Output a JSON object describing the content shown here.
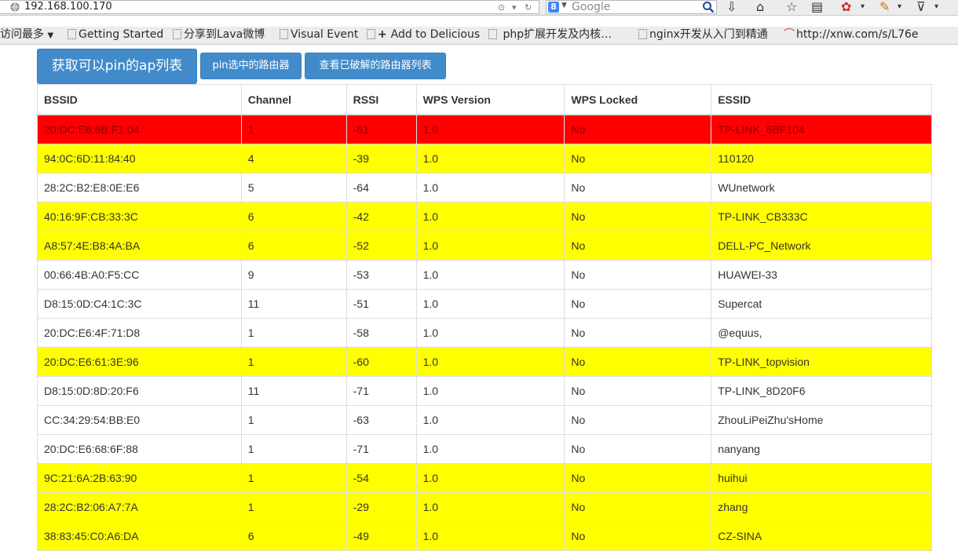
{
  "browser": {
    "url": "192.168.100.170",
    "search_placeholder": "Google",
    "search_engine_letter": "8"
  },
  "bookmarks": {
    "most_visited": "访问最多",
    "items": [
      "Getting Started",
      "分享到Lava微博",
      "Visual Event",
      "Add to Delicious",
      "php扩展开发及内核…",
      "nginx开发从入门到精通",
      "http://xnw.com/s/L76e"
    ]
  },
  "actions": {
    "get_pin_ap": "获取可以pin的ap列表",
    "pin_selected": "pin选中的路由器",
    "view_cracked": "查看已破解的路由器列表"
  },
  "table": {
    "headers": [
      "BSSID",
      "Channel",
      "RSSI",
      "WPS Version",
      "WPS Locked",
      "ESSID"
    ],
    "rows": [
      {
        "highlight": "red",
        "cells": [
          "20:DC:E6:6B:F1:04",
          "1",
          "-61",
          "1.0",
          "No",
          "TP-LINK_6BF104"
        ]
      },
      {
        "highlight": "yellow",
        "cells": [
          "94:0C:6D:11:84:40",
          "4",
          "-39",
          "1.0",
          "No",
          "110120"
        ]
      },
      {
        "highlight": "white",
        "cells": [
          "28:2C:B2:E8:0E:E6",
          "5",
          "-64",
          "1.0",
          "No",
          "WUnetwork"
        ]
      },
      {
        "highlight": "yellow",
        "cells": [
          "40:16:9F:CB:33:3C",
          "6",
          "-42",
          "1.0",
          "No",
          "TP-LINK_CB333C"
        ]
      },
      {
        "highlight": "yellow",
        "cells": [
          "A8:57:4E:B8:4A:BA",
          "6",
          "-52",
          "1.0",
          "No",
          "DELL-PC_Network"
        ]
      },
      {
        "highlight": "white",
        "cells": [
          "00:66:4B:A0:F5:CC",
          "9",
          "-53",
          "1.0",
          "No",
          "HUAWEI-33"
        ]
      },
      {
        "highlight": "white",
        "cells": [
          "D8:15:0D:C4:1C:3C",
          "11",
          "-51",
          "1.0",
          "No",
          "Supercat"
        ]
      },
      {
        "highlight": "white",
        "cells": [
          "20:DC:E6:4F:71:D8",
          "1",
          "-58",
          "1.0",
          "No",
          "@equus,"
        ]
      },
      {
        "highlight": "yellow",
        "cells": [
          "20:DC:E6:61:3E:96",
          "1",
          "-60",
          "1.0",
          "No",
          "TP-LINK_topvision"
        ]
      },
      {
        "highlight": "white",
        "cells": [
          "D8:15:0D:8D:20:F6",
          "11",
          "-71",
          "1.0",
          "No",
          "TP-LINK_8D20F6"
        ]
      },
      {
        "highlight": "white",
        "cells": [
          "CC:34:29:54:BB:E0",
          "1",
          "-63",
          "1.0",
          "No",
          "ZhouLiPeiZhu'sHome"
        ]
      },
      {
        "highlight": "white",
        "cells": [
          "20:DC:E6:68:6F:88",
          "1",
          "-71",
          "1.0",
          "No",
          "nanyang"
        ]
      },
      {
        "highlight": "yellow",
        "cells": [
          "9C:21:6A:2B:63:90",
          "1",
          "-54",
          "1.0",
          "No",
          "huihui"
        ]
      },
      {
        "highlight": "yellow",
        "cells": [
          "28:2C:B2:06:A7:7A",
          "1",
          "-29",
          "1.0",
          "No",
          "zhang"
        ]
      },
      {
        "highlight": "yellow",
        "cells": [
          "38:83:45:C0:A6:DA",
          "6",
          "-49",
          "1.0",
          "No",
          "CZ-SINA"
        ]
      }
    ]
  },
  "colors": {
    "accent": "#428bca",
    "row_red": "#ff0000",
    "row_yellow": "#ffff00"
  }
}
